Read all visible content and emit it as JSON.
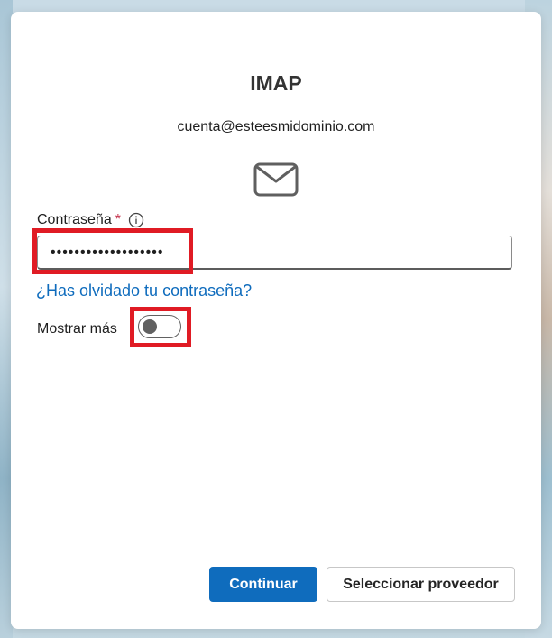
{
  "dialog": {
    "title": "IMAP",
    "account": "cuenta@esteesmidominio.com",
    "password": {
      "label": "Contraseña",
      "required_marker": "*",
      "value": "•••••••••••••••••••"
    },
    "forgot_link": "¿Has olvidado tu contraseña?",
    "show_more": {
      "label": "Mostrar más",
      "enabled": false
    },
    "buttons": {
      "continue": "Continuar",
      "select_provider": "Seleccionar proveedor"
    }
  },
  "colors": {
    "accent": "#0f6cbd",
    "highlight": "#e01b24",
    "required": "#c4314b"
  },
  "icons": {
    "mail": "mail-icon",
    "info": "info-icon"
  }
}
